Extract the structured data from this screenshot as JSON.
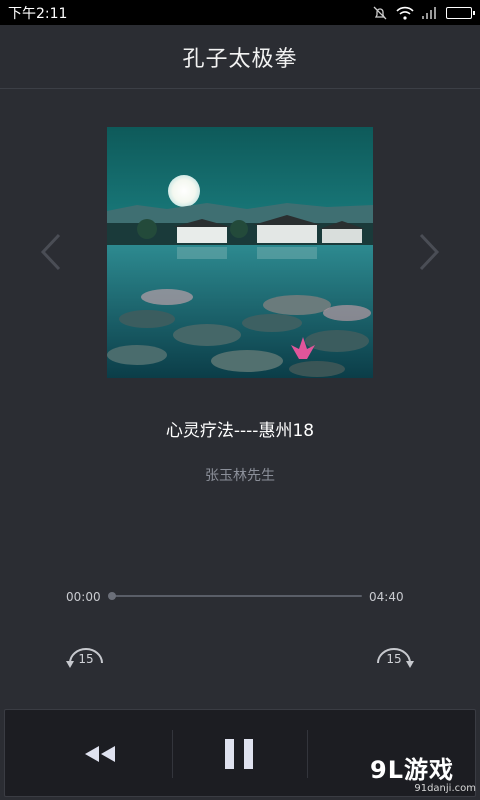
{
  "status_bar": {
    "time": "下午2:11",
    "icons": [
      "alarm-off-icon",
      "wifi-icon",
      "signal-icon",
      "battery-icon"
    ]
  },
  "header": {
    "title": "孔子太极拳"
  },
  "player": {
    "track_title": "心灵疗法----惠州18",
    "artist": "张玉林先生",
    "current_time": "00:00",
    "total_time": "04:40",
    "progress": 0,
    "skip_back_seconds": "15",
    "skip_forward_seconds": "15"
  },
  "controls": [
    "rewind",
    "pause"
  ],
  "watermark": {
    "logo": "9L游戏",
    "url": "91danji.com"
  },
  "colors": {
    "background": "#2b2d33",
    "control_bar": "#1c1d22",
    "secondary_text": "#8b8f99",
    "battery": "#2ecc40"
  }
}
